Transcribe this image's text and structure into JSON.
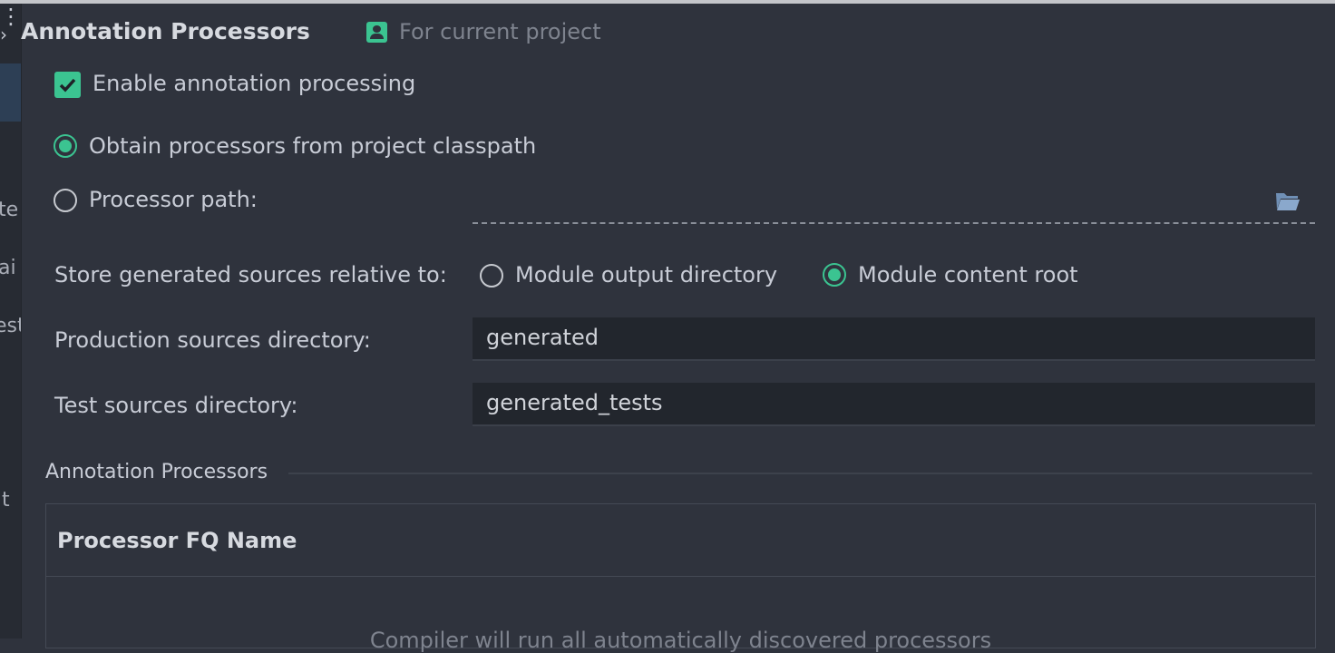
{
  "header": {
    "title": "Annotation Processors",
    "scope_label": "For current project"
  },
  "sidebar": {
    "fragments": [
      "te",
      "ai",
      "est",
      "t"
    ]
  },
  "options": {
    "enable_processing": {
      "label": "Enable annotation processing",
      "checked": true
    },
    "obtain_classpath": {
      "label": "Obtain processors from project classpath",
      "selected": true
    },
    "processor_path": {
      "label": "Processor path:",
      "selected": false,
      "value": ""
    }
  },
  "store_relative": {
    "label": "Store generated sources relative to:",
    "module_output": {
      "label": "Module output directory",
      "selected": false
    },
    "module_content": {
      "label": "Module content root",
      "selected": true
    }
  },
  "production_dir": {
    "label": "Production sources directory:",
    "value": "generated"
  },
  "test_dir": {
    "label": "Test sources directory:",
    "value": "generated_tests"
  },
  "processors_section": {
    "title": "Annotation Processors",
    "column_header": "Processor FQ Name",
    "empty_text": "Compiler will run all automatically discovered processors"
  },
  "colors": {
    "accent": "#3bc491",
    "background": "#2f333d"
  },
  "icons": [
    "collapse-arrow-icon",
    "project-icon",
    "checkbox-checked-icon",
    "folder-icon",
    "drag-handle-icon"
  ]
}
